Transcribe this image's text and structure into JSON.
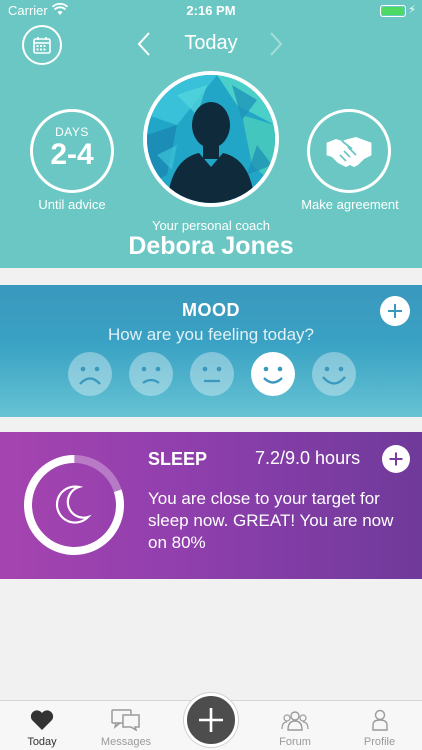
{
  "status_bar": {
    "carrier": "Carrier",
    "time": "2:16 PM"
  },
  "header": {
    "title": "Today",
    "days_caption": "DAYS",
    "days_value": "2-4",
    "days_label": "Until advice",
    "coach_label": "Your personal coach",
    "coach_name": "Debora Jones",
    "agreement_label": "Make agreement",
    "accent": "#6bc7c3"
  },
  "mood": {
    "title": "MOOD",
    "question": "How are you feeling today?",
    "options": [
      "very-sad",
      "sad",
      "neutral",
      "happy",
      "very-happy"
    ],
    "selected": "happy"
  },
  "sleep": {
    "title": "SLEEP",
    "hours": "7.2/9.0 hours",
    "message": "You are close to your target for sleep now. GREAT! You are now on 80%",
    "progress": 0.8
  },
  "tabs": {
    "today": "Today",
    "messages": "Messages",
    "forum": "Forum",
    "profile": "Profile",
    "active": "today"
  },
  "colors": {
    "mood_bg": "#3aa2c4",
    "sleep_bg": "#8f3fad",
    "tab_active": "#333333"
  }
}
